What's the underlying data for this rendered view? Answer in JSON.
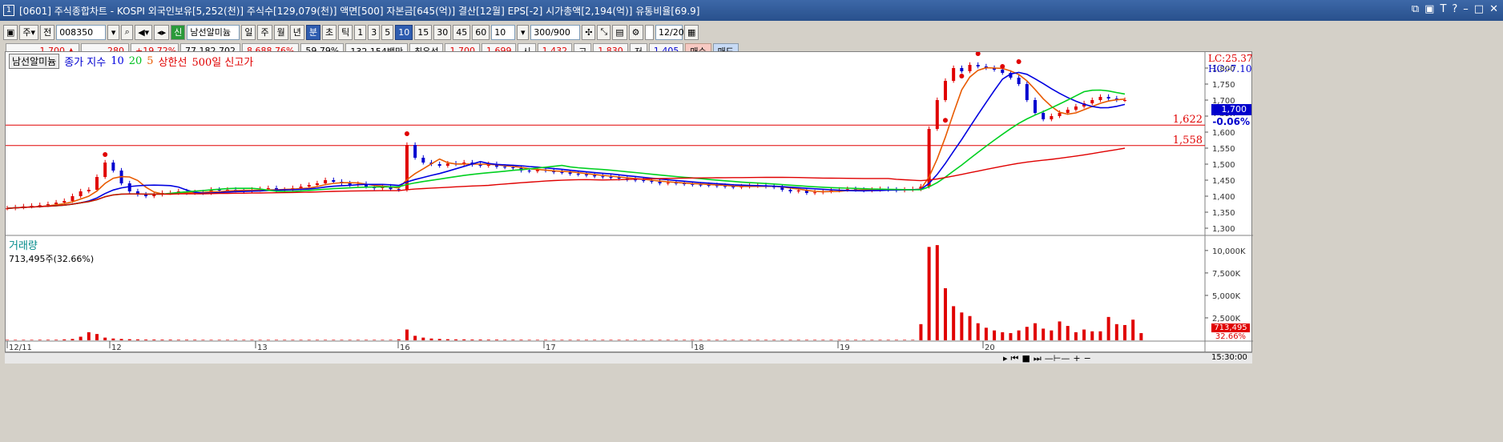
{
  "title": {
    "text": "[0601] 주식종합차트 - KOSPI 외국인보유[5,252(천)] 주식수[129,079(천)] 액면[500] 자본금[645(억)] 결산[12월] EPS[-2] 시가총액[2,194(억)] 유통비율[69.9]",
    "icon": "1"
  },
  "toolbar": {
    "type_sel": "주",
    "mode_sel": "전",
    "code": "008350",
    "name_badge": "신",
    "name": "남선알미늄",
    "periods": [
      "일",
      "주",
      "월",
      "년",
      "분",
      "초",
      "틱"
    ],
    "active_period": "분",
    "intervals": [
      "1",
      "3",
      "5",
      "10",
      "15",
      "30",
      "45",
      "60"
    ],
    "active_interval": "10",
    "interval_sel": "10",
    "count": "300",
    "count_total": "/900",
    "date": "12/20"
  },
  "quote": {
    "price": "1,700",
    "arrow": "▲",
    "change": "280",
    "rate": "+19.72%",
    "volume": "77,182,702",
    "vol_ratio": "8,688.76%",
    "pct": "59.79%",
    "amount": "132,154백만",
    "best_label": "최우선",
    "ask": "1,700",
    "bid": "1,699",
    "open_label": "시",
    "open": "1,432",
    "high_label": "고",
    "high": "1,830",
    "low_label": "저",
    "low": "1,405",
    "buy": "매수",
    "sell": "매도"
  },
  "legend": {
    "name": "남선알미늄",
    "ma_label": "종가 지수",
    "ma10": "10",
    "ma20": "20",
    "ma5": "5",
    "limit": "상한선",
    "high500": "500일 신고가"
  },
  "side": {
    "lc": "LC:25.37",
    "hc": "HC:-7.10",
    "price": "1,700",
    "change": "-0.06%",
    "level1": "1,622",
    "level2": "1,558"
  },
  "volume_legend": {
    "title": "거래량",
    "value": "713,495주(32.66%)",
    "box1": "713,495",
    "box2": "32.66%"
  },
  "bottom": {
    "time": "15:30:00"
  },
  "colors": {
    "up": "#e00000",
    "down": "#0000d0",
    "ma5": "#e85a00",
    "ma10": "#0000e0",
    "ma20": "#00d020",
    "limit": "#e00000",
    "grid": "#c8c8c8"
  },
  "chart_data": {
    "type": "candlestick",
    "price_axis": {
      "ticks": [
        "1,800",
        "1,750",
        "1,700",
        "1,650",
        "1,600",
        "1,550",
        "1,500",
        "1,450",
        "1,400",
        "1,350",
        "1,300"
      ],
      "range": [
        1280,
        1830
      ]
    },
    "volume_axis": {
      "ticks": [
        "10,000K",
        "7,500K",
        "5,000K",
        "2,500K"
      ],
      "range": [
        0,
        10700000
      ]
    },
    "x_labels": [
      "12/11",
      "12",
      "13",
      "16",
      "17",
      "18",
      "19",
      "20"
    ],
    "hlines": [
      1622,
      1558
    ],
    "close_series": [
      1362,
      1365,
      1368,
      1370,
      1372,
      1375,
      1380,
      1385,
      1400,
      1415,
      1420,
      1460,
      1505,
      1480,
      1440,
      1415,
      1405,
      1400,
      1405,
      1410,
      1410,
      1415,
      1410,
      1412,
      1410,
      1420,
      1418,
      1420,
      1418,
      1415,
      1420,
      1422,
      1425,
      1418,
      1420,
      1425,
      1430,
      1435,
      1440,
      1450,
      1445,
      1440,
      1435,
      1438,
      1430,
      1425,
      1430,
      1422,
      1420,
      1560,
      1520,
      1505,
      1500,
      1495,
      1502,
      1500,
      1505,
      1498,
      1495,
      1500,
      1492,
      1490,
      1488,
      1480,
      1478,
      1482,
      1480,
      1475,
      1474,
      1470,
      1468,
      1465,
      1462,
      1460,
      1458,
      1455,
      1452,
      1450,
      1448,
      1445,
      1440,
      1442,
      1440,
      1438,
      1436,
      1435,
      1434,
      1432,
      1430,
      1428,
      1430,
      1432,
      1434,
      1430,
      1428,
      1420,
      1415,
      1418,
      1410,
      1412,
      1415,
      1418,
      1420,
      1422,
      1420,
      1418,
      1420,
      1422,
      1420,
      1418,
      1420,
      1422,
      1430,
      1610,
      1700,
      1760,
      1800,
      1790,
      1810,
      1805,
      1800,
      1795,
      1785,
      1770,
      1750,
      1700,
      1660,
      1640,
      1650,
      1660,
      1670,
      1680,
      1690,
      1700,
      1710,
      1705,
      1700,
      1700
    ],
    "volume": [
      0.05,
      0.05,
      0.05,
      0.05,
      0.06,
      0.06,
      0.06,
      0.1,
      0.15,
      0.4,
      0.9,
      0.7,
      0.3,
      0.2,
      0.15,
      0.12,
      0.1,
      0.08,
      0.08,
      0.07,
      0.07,
      0.06,
      0.06,
      0.06,
      0.05,
      0.05,
      0.05,
      0.05,
      0.05,
      0.05,
      0.05,
      0.05,
      0.05,
      0.05,
      0.05,
      0.05,
      0.05,
      0.05,
      0.05,
      0.05,
      0.05,
      0.05,
      0.05,
      0.05,
      0.05,
      0.05,
      0.05,
      0.05,
      0.1,
      1.2,
      0.5,
      0.3,
      0.2,
      0.15,
      0.12,
      0.1,
      0.1,
      0.08,
      0.08,
      0.07,
      0.07,
      0.06,
      0.06,
      0.06,
      0.05,
      0.05,
      0.05,
      0.05,
      0.05,
      0.05,
      0.05,
      0.05,
      0.05,
      0.05,
      0.05,
      0.05,
      0.05,
      0.05,
      0.05,
      0.05,
      0.05,
      0.05,
      0.05,
      0.05,
      0.05,
      0.05,
      0.05,
      0.05,
      0.05,
      0.05,
      0.05,
      0.05,
      0.05,
      0.05,
      0.05,
      0.05,
      0.05,
      0.05,
      0.05,
      0.05,
      0.05,
      0.05,
      0.05,
      0.05,
      0.05,
      0.05,
      0.05,
      0.05,
      0.05,
      0.05,
      0.05,
      0.05,
      1.8,
      10.4,
      10.6,
      5.8,
      3.8,
      3.1,
      2.7,
      1.9,
      1.4,
      1.1,
      0.9,
      0.8,
      1.1,
      1.5,
      1.9,
      1.3,
      1.1,
      2.1,
      1.6,
      0.9,
      1.2,
      1.0,
      1.0,
      2.6,
      1.8,
      1.7,
      2.3,
      0.8
    ]
  }
}
